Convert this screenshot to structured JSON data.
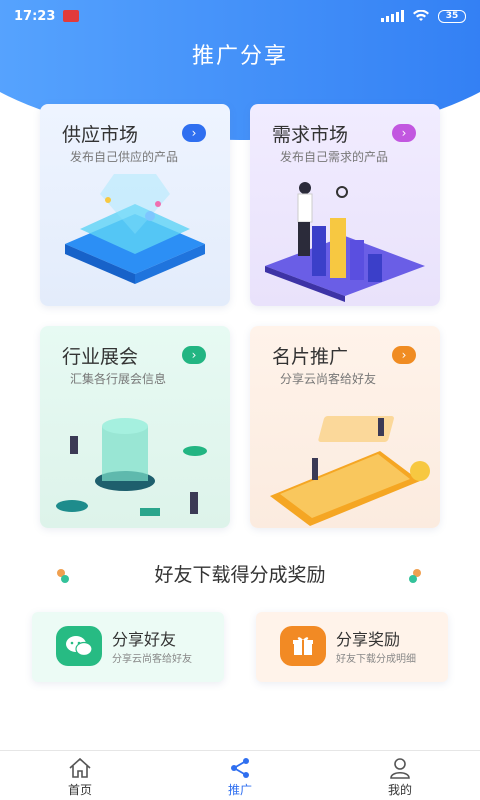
{
  "status_bar": {
    "time": "17:23",
    "battery": "35"
  },
  "page": {
    "title": "推广分享"
  },
  "cards": [
    {
      "title": "供应市场",
      "subtitle": "发布自己供应的产品",
      "accent": "#2f6ff0",
      "arrow": "›"
    },
    {
      "title": "需求市场",
      "subtitle": "发布自己需求的产品",
      "accent": "#c257e0",
      "arrow": "›"
    },
    {
      "title": "行业展会",
      "subtitle": "汇集各行展会信息",
      "accent": "#22b582",
      "arrow": "›"
    },
    {
      "title": "名片推广",
      "subtitle": "分享云尚客给好友",
      "accent": "#f08c22",
      "arrow": "›"
    }
  ],
  "reward": {
    "heading": "好友下载得分成奖励"
  },
  "share": [
    {
      "title": "分享好友",
      "subtitle": "分享云尚客给好友",
      "icon": "wechat-icon"
    },
    {
      "title": "分享奖励",
      "subtitle": "好友下载分成明细",
      "icon": "gift-icon"
    }
  ],
  "nav": [
    {
      "label": "首页",
      "icon": "home-icon"
    },
    {
      "label": "推广",
      "icon": "share-icon",
      "active": true
    },
    {
      "label": "我的",
      "icon": "user-icon"
    }
  ]
}
